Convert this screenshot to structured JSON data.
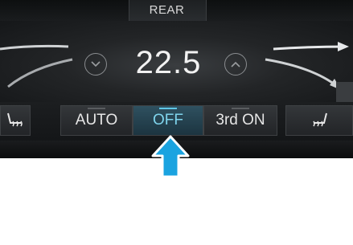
{
  "header": {
    "title": "REAR"
  },
  "temperature": {
    "value": "22.5"
  },
  "icons": {
    "down": "chevron-down-icon",
    "up": "chevron-up-icon",
    "seat_left": "heated-seat-icon",
    "seat_right": "heated-seat-icon",
    "pointer": "arrow-up-icon"
  },
  "buttons": {
    "auto": "AUTO",
    "off": "OFF",
    "third_row": "3rd ON"
  },
  "colors": {
    "active_text": "#7fd4ec",
    "pointer_fill": "#1aa3e0"
  }
}
